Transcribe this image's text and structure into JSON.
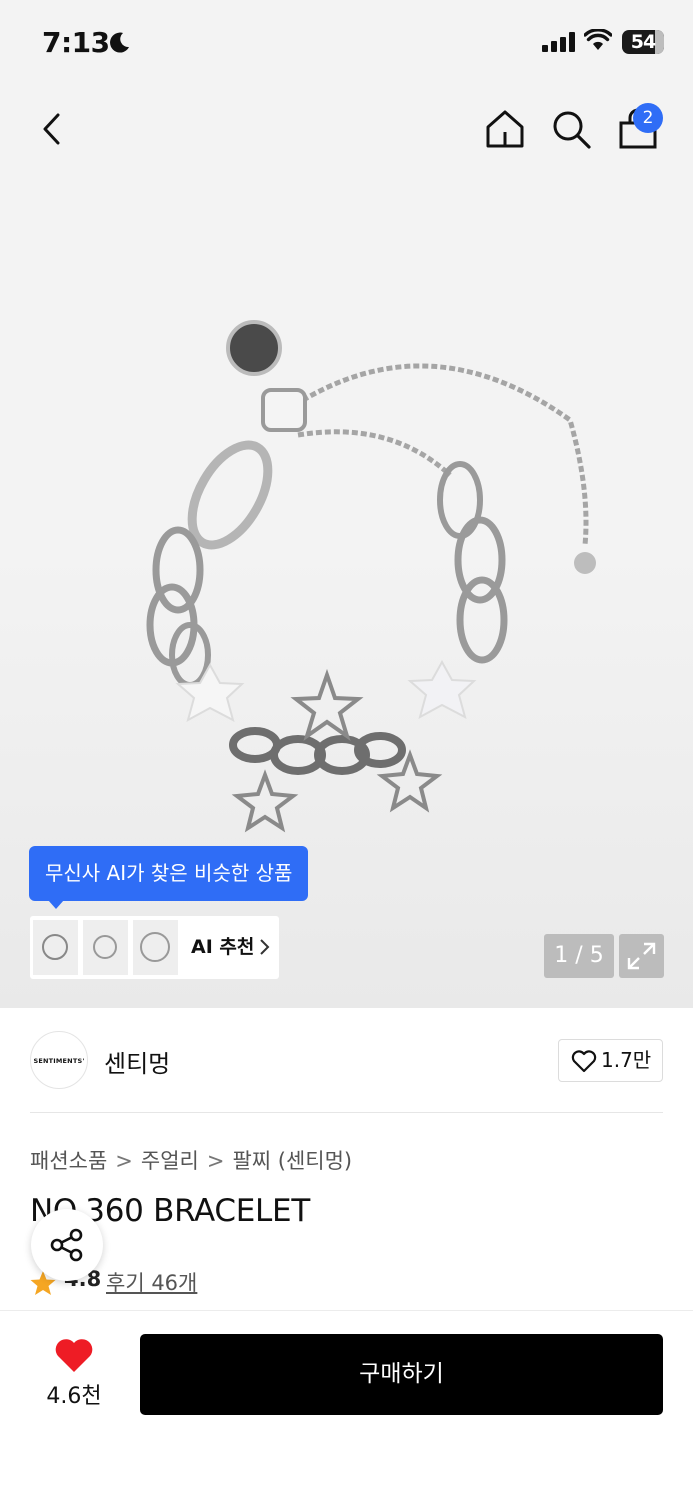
{
  "status_bar": {
    "time": "7:13",
    "battery": "54"
  },
  "header": {
    "cart_count": "2"
  },
  "gallery": {
    "page_counter": "1 / 5"
  },
  "ai_reco": {
    "tooltip": "무신사 AI가 찾은 비슷한 상품",
    "label": "AI 추천"
  },
  "brand": {
    "logo_text": "SENTIMENTS'",
    "name": "센티멍",
    "like_count": "1.7만"
  },
  "breadcrumb": [
    "패션소품",
    "주얼리",
    "팔찌 (센티멍)"
  ],
  "product": {
    "title": "NO.360 BRACELET",
    "rating": "4.8",
    "reviews": "후기 46개"
  },
  "bottom_bar": {
    "like_count": "4.6천",
    "buy_label": "구매하기"
  },
  "colors": {
    "accent": "#2f6df6",
    "heart": "#ee1c25",
    "star": "#f5a623",
    "buy": "#000000"
  }
}
